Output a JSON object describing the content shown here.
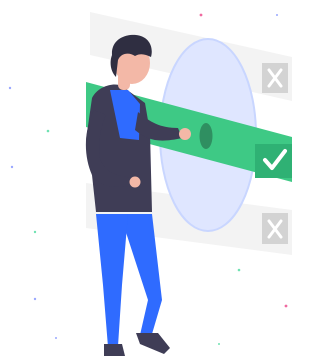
{
  "illustration": {
    "colors": {
      "background": "#ffffff",
      "panel_gray": "#f0f0f0",
      "panel_gray_dark": "#e6e6e6",
      "x_box": "#cfcfcf",
      "accent_green": "#3ec985",
      "accent_green_dark": "#2fb174",
      "oval_blue": "#dfe6ff",
      "oval_stroke": "#c7d3ff",
      "jacket": "#3f3d56",
      "shirt": "#2f6bff",
      "pants": "#2f6bff",
      "skin": "#f3b8a7",
      "hair": "#2f2e41",
      "shoes": "#3f3d56"
    },
    "icons": {
      "top_row_icon": "x-icon",
      "middle_row_icon": "check-icon",
      "bottom_row_icon": "x-icon",
      "toggle_knob_icon": "toggle-knob-icon"
    },
    "selection": {
      "top_row_selected": false,
      "middle_row_selected": true,
      "bottom_row_selected": false
    }
  }
}
